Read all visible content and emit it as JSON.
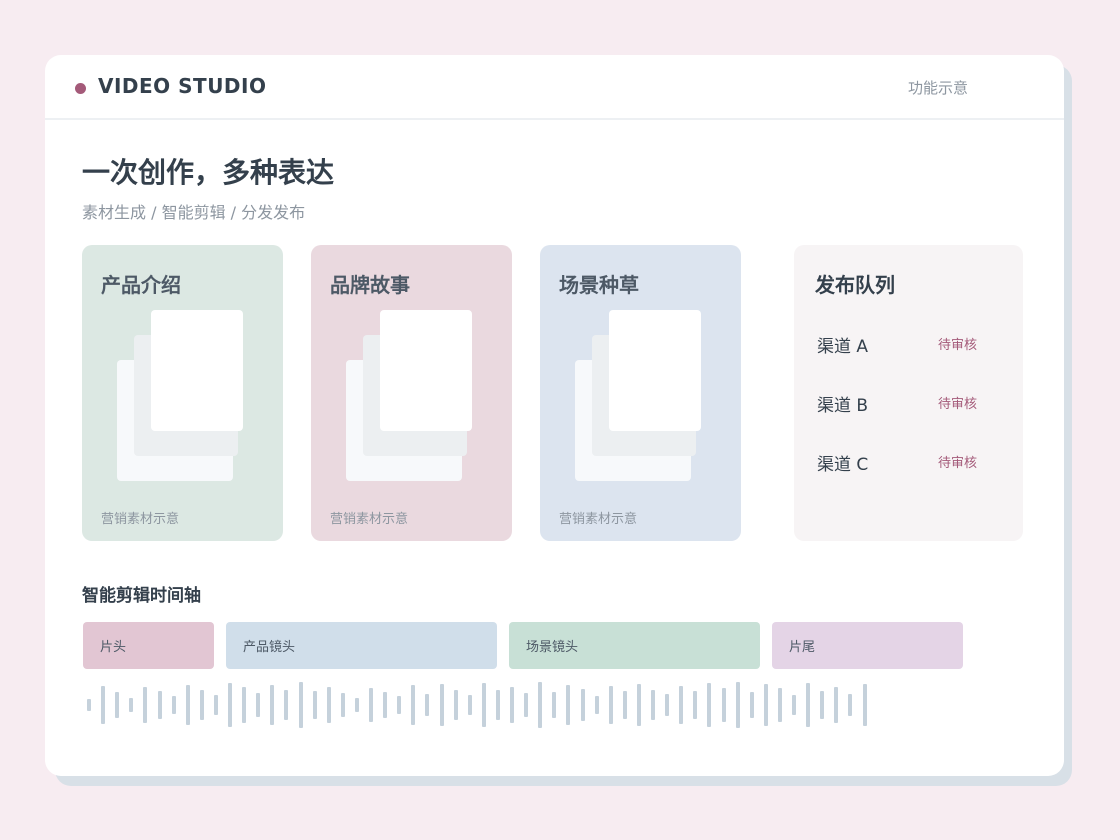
{
  "app": {
    "brand": "VIDEO STUDIO",
    "top_link": "功能示意"
  },
  "hero": {
    "title": "一次创作，多种表达",
    "subtitle": "素材生成 / 智能剪辑 / 分发发布"
  },
  "tiles": [
    {
      "title": "产品介绍",
      "caption": "营销素材示意",
      "color": "#dce8e3"
    },
    {
      "title": "品牌故事",
      "caption": "营销素材示意",
      "color": "#ead9df"
    },
    {
      "title": "场景种草",
      "caption": "营销素材示意",
      "color": "#dce4ef"
    }
  ],
  "queue": {
    "title": "发布队列",
    "items": [
      {
        "channel": "渠道 A",
        "status": "待审核"
      },
      {
        "channel": "渠道 B",
        "status": "待审核"
      },
      {
        "channel": "渠道 C",
        "status": "待审核"
      }
    ]
  },
  "timeline": {
    "title": "智能剪辑时间轴",
    "clips": [
      {
        "label": "片头",
        "color": "#e2c6d3"
      },
      {
        "label": "产品镜头",
        "color": "#d0deea"
      },
      {
        "label": "场景镜头",
        "color": "#c8e0d6"
      },
      {
        "label": "片尾",
        "color": "#e4d4e6"
      }
    ],
    "waveform_color": "#c5d1db"
  },
  "colors": {
    "background": "#f7ecf1",
    "accent": "#a45a79",
    "text_dark": "#34404c",
    "text_muted": "#8d96a0"
  }
}
